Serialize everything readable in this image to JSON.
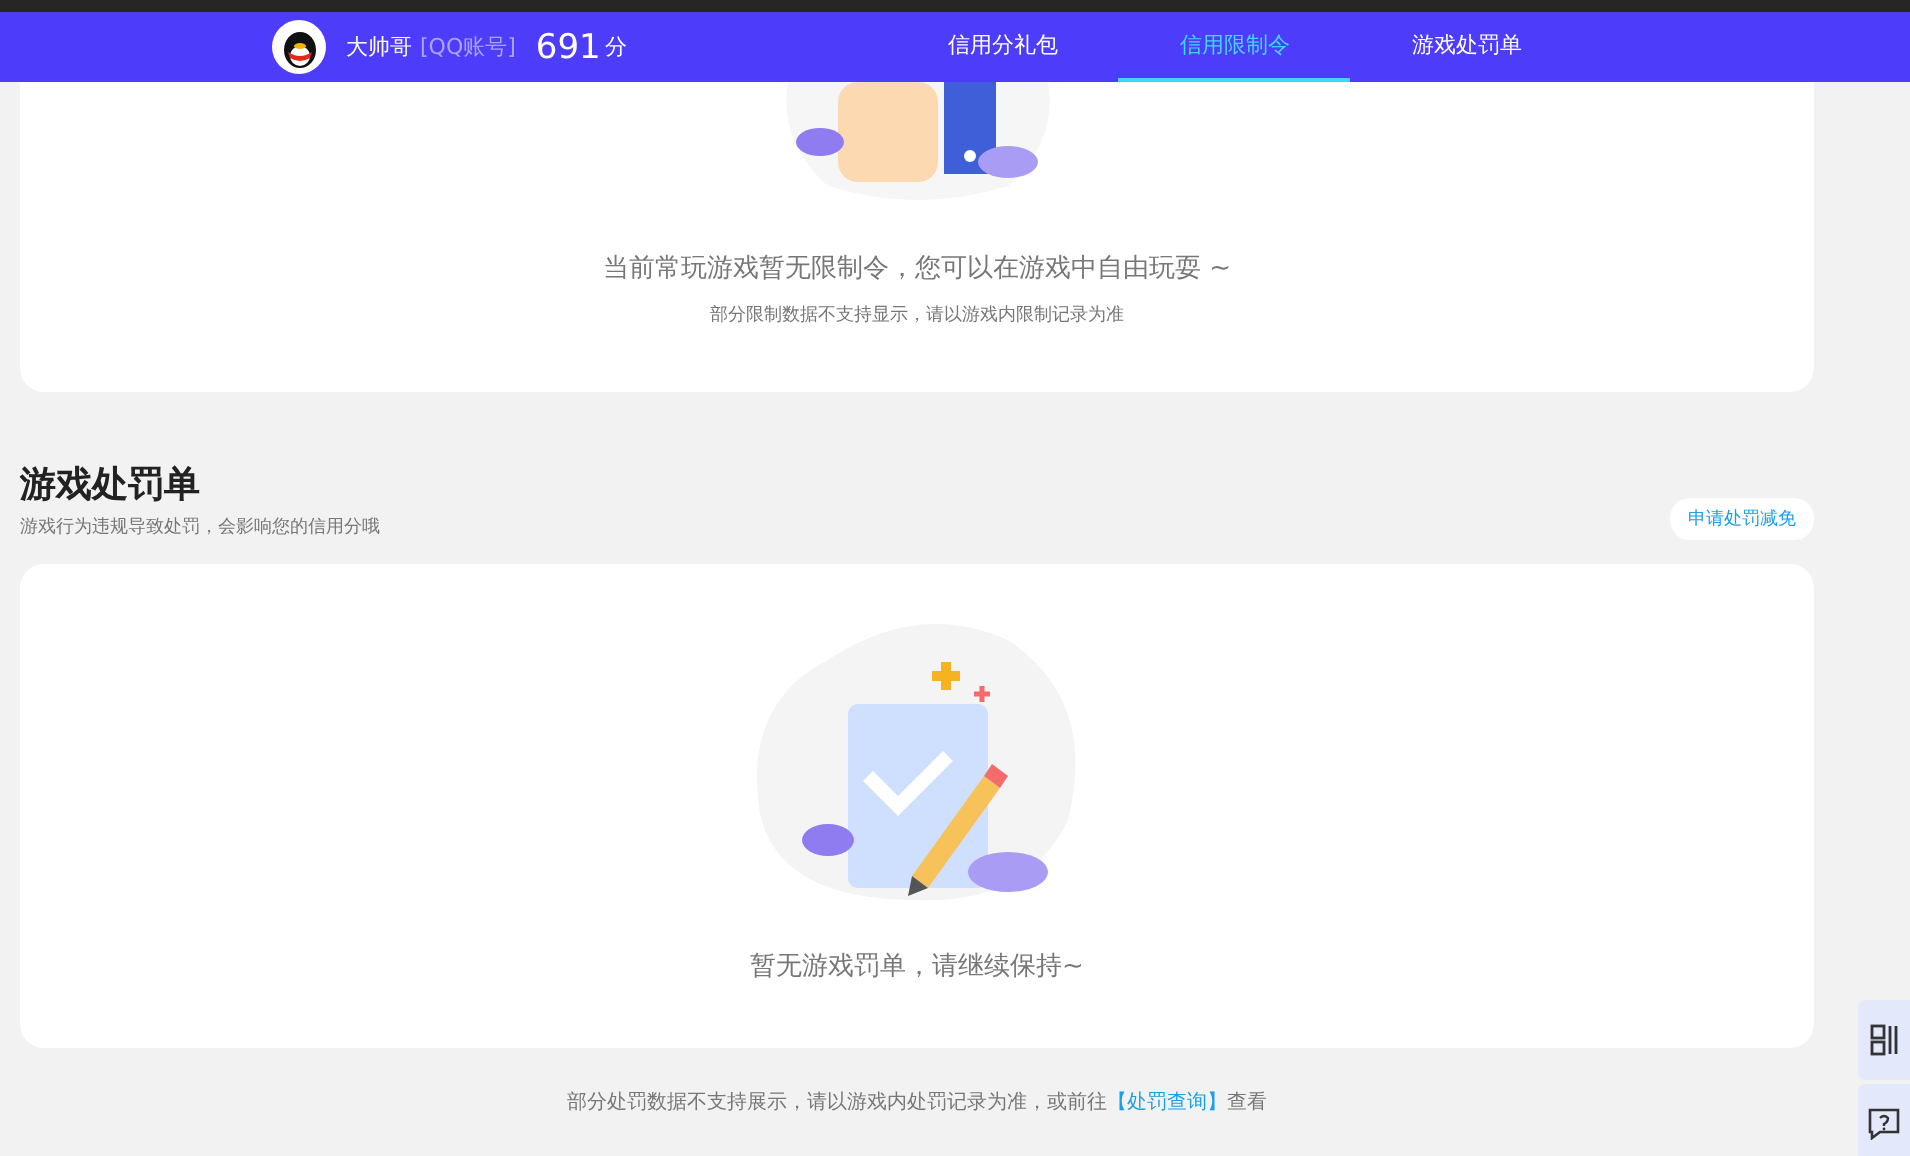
{
  "nav": {
    "user_name": "大帅哥",
    "account_type": "[QQ账号]",
    "score": "691",
    "score_unit": "分",
    "tabs": [
      {
        "label": "信用分礼包",
        "selected": false
      },
      {
        "label": "信用限制令",
        "selected": true
      },
      {
        "label": "游戏处罚单",
        "selected": false
      }
    ]
  },
  "restriction_card": {
    "message": "当前常玩游戏暂无限制令，您可以在游戏中自由玩耍 ~",
    "note": "部分限制数据不支持显示，请以游戏内限制记录为准"
  },
  "penalty_section": {
    "title": "游戏处罚单",
    "subtitle": "游戏行为违规导致处罚，会影响您的信用分哦",
    "action": "申请处罚减免",
    "message": "暂无游戏罚单，请继续保持~"
  },
  "footer": {
    "text_before": "部分处罚数据不支持展示，请以游戏内处罚记录为准，或前往",
    "link": "【处罚查询】",
    "text_after": "查看"
  }
}
